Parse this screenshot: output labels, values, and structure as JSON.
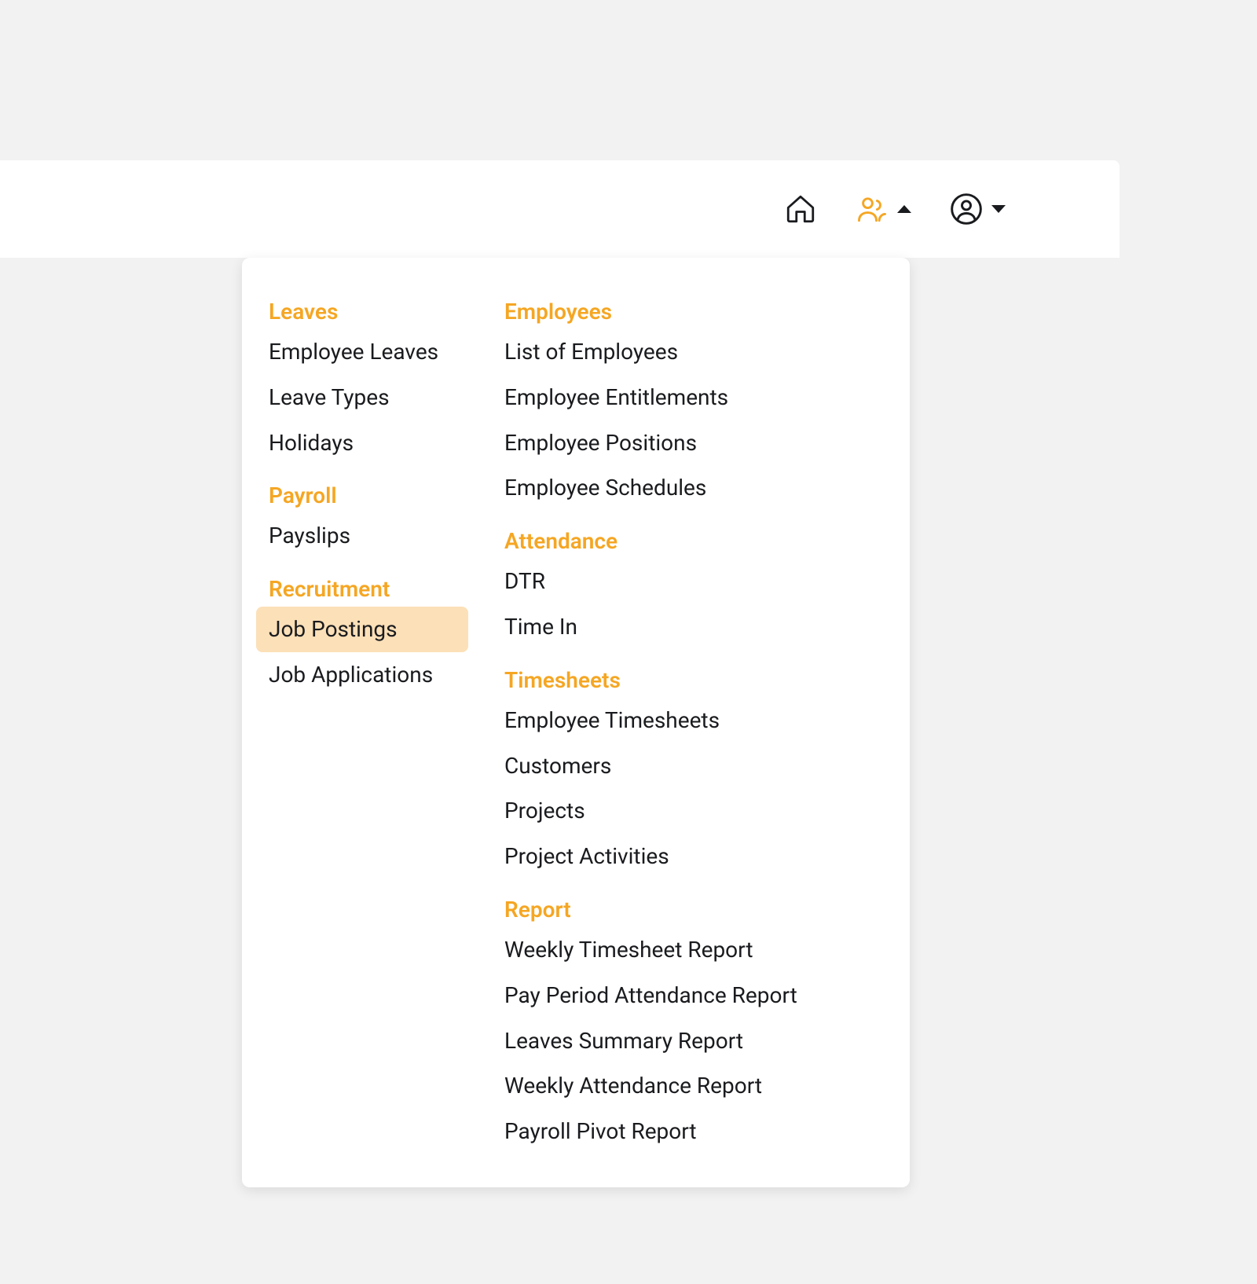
{
  "colors": {
    "accent": "#f5a623",
    "highlightBg": "#fce0b8",
    "iconDark": "#1a1b1e"
  },
  "topbar": {
    "homeIcon": "home-icon",
    "peopleIcon": "people-icon",
    "userIcon": "user-icon"
  },
  "menu": {
    "columns": [
      {
        "sections": [
          {
            "title": "Leaves",
            "items": [
              {
                "label": "Employee Leaves",
                "highlighted": false
              },
              {
                "label": "Leave Types",
                "highlighted": false
              },
              {
                "label": "Holidays",
                "highlighted": false
              }
            ]
          },
          {
            "title": "Payroll",
            "items": [
              {
                "label": "Payslips",
                "highlighted": false
              }
            ]
          },
          {
            "title": "Recruitment",
            "items": [
              {
                "label": "Job Postings",
                "highlighted": true
              },
              {
                "label": "Job Applications",
                "highlighted": false
              }
            ]
          }
        ]
      },
      {
        "sections": [
          {
            "title": "Employees",
            "items": [
              {
                "label": "List of Employees",
                "highlighted": false
              },
              {
                "label": "Employee Entitlements",
                "highlighted": false
              },
              {
                "label": "Employee Positions",
                "highlighted": false
              },
              {
                "label": "Employee Schedules",
                "highlighted": false
              }
            ]
          },
          {
            "title": "Attendance",
            "items": [
              {
                "label": "DTR",
                "highlighted": false
              },
              {
                "label": "Time In",
                "highlighted": false
              }
            ]
          },
          {
            "title": "Timesheets",
            "items": [
              {
                "label": "Employee Timesheets",
                "highlighted": false
              },
              {
                "label": "Customers",
                "highlighted": false
              },
              {
                "label": "Projects",
                "highlighted": false
              },
              {
                "label": "Project Activities",
                "highlighted": false
              }
            ]
          },
          {
            "title": "Report",
            "items": [
              {
                "label": "Weekly Timesheet Report",
                "highlighted": false
              },
              {
                "label": "Pay Period Attendance Report",
                "highlighted": false
              },
              {
                "label": "Leaves Summary Report",
                "highlighted": false
              },
              {
                "label": "Weekly Attendance Report",
                "highlighted": false
              },
              {
                "label": "Payroll Pivot Report",
                "highlighted": false
              }
            ]
          }
        ]
      }
    ]
  }
}
